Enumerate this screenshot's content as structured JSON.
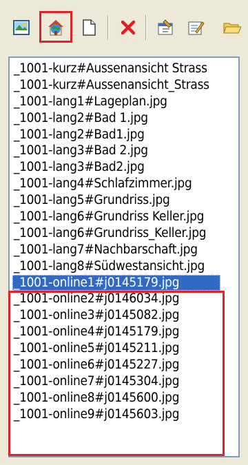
{
  "toolbar": {
    "buttons": [
      {
        "icon": "image-icon"
      },
      {
        "icon": "web-image-icon",
        "highlighted": true
      },
      {
        "icon": "new-document-icon"
      },
      {
        "icon": "delete-icon"
      },
      {
        "icon": "properties-icon"
      },
      {
        "icon": "edit-icon"
      },
      {
        "icon": "open-folder-icon"
      }
    ]
  },
  "file_list": {
    "items": [
      "_1001-kurz#Aussenansicht Strass",
      "_1001-kurz#Aussenansicht_Strass",
      "_1001-lang1#Lageplan.jpg",
      "_1001-lang2#Bad 1.jpg",
      "_1001-lang2#Bad1.jpg",
      "_1001-lang3#Bad 2.jpg",
      "_1001-lang3#Bad2.jpg",
      "_1001-lang4#Schlafzimmer.jpg",
      "_1001-lang5#Grundriss.jpg",
      "_1001-lang6#Grundriss Keller.jpg",
      "_1001-lang6#Grundriss_Keller.jpg",
      "_1001-lang7#Nachbarschaft.jpg",
      "_1001-lang8#Südwestansicht.jpg",
      "_1001-online1#j0145179.jpg",
      "_1001-online2#j0146034.jpg",
      "_1001-online3#j0145082.jpg",
      "_1001-online4#j0145179.jpg",
      "_1001-online5#j0145211.jpg",
      "_1001-online6#j0145227.jpg",
      "_1001-online7#j0145304.jpg",
      "_1001-online8#j0145600.jpg",
      "_1001-online9#j0145603.jpg"
    ],
    "selected_index": 13
  },
  "colors": {
    "highlight_frame": "#e5202b",
    "selection": "#316ac5",
    "list_border": "#7f9db9",
    "background": "#ece9d8"
  }
}
